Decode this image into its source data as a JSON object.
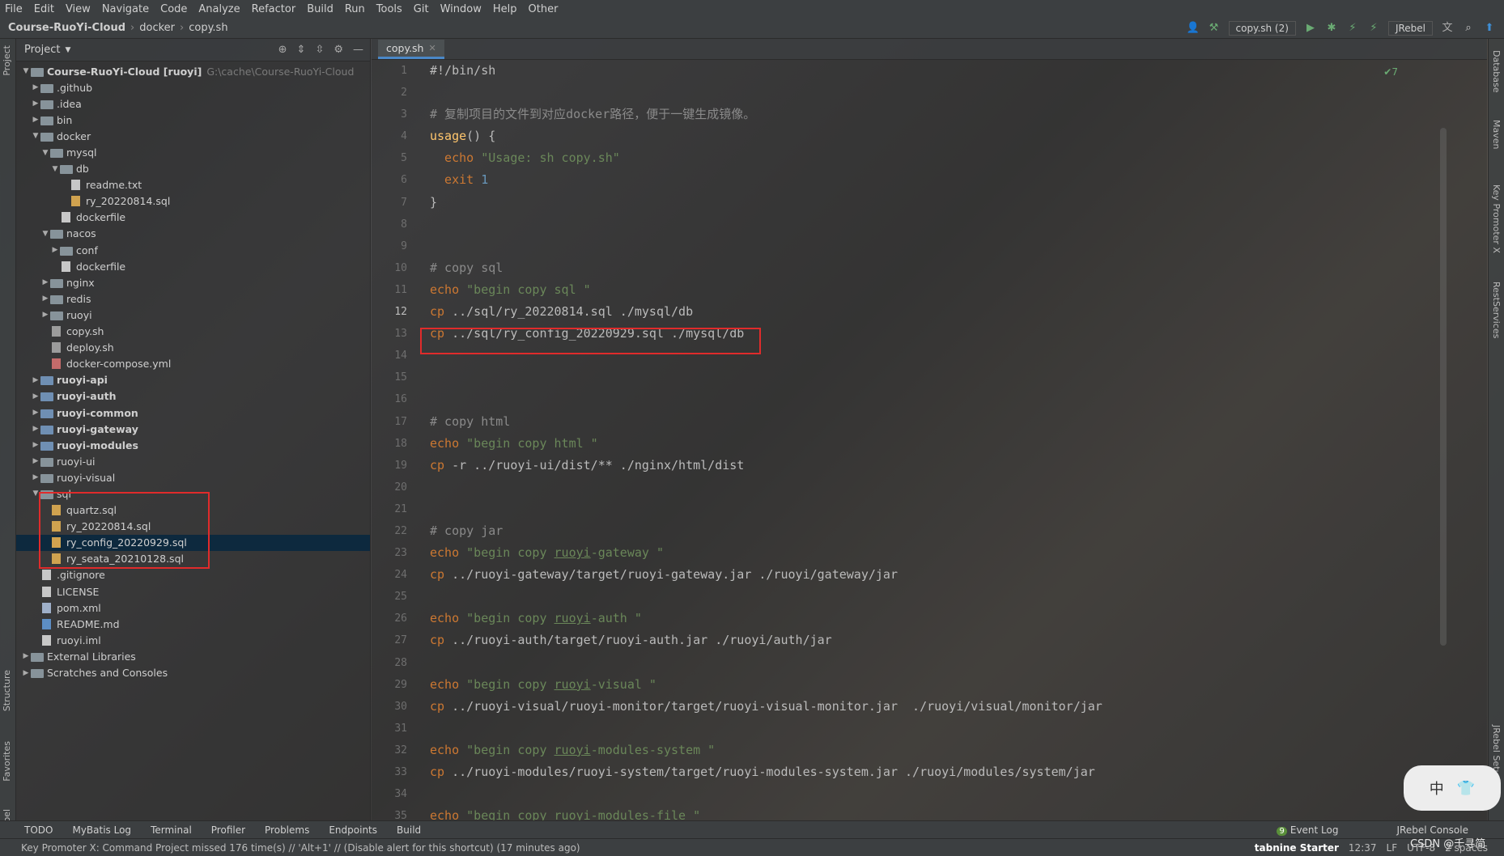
{
  "menu": [
    "File",
    "Edit",
    "View",
    "Navigate",
    "Code",
    "Analyze",
    "Refactor",
    "Build",
    "Run",
    "Tools",
    "Git",
    "Window",
    "Help",
    "Other"
  ],
  "breadcrumb": [
    "Course-RuoYi-Cloud",
    "docker",
    "copy.sh"
  ],
  "toolbar": {
    "run_config": "copy.sh (2)",
    "jrebel": "JRebel"
  },
  "project": {
    "title": "Project",
    "tree": [
      {
        "label": "Course-RuoYi-Cloud [ruoyi]",
        "extra": "G:\\cache\\Course-RuoYi-Cloud",
        "depth": 0,
        "type": "folder",
        "open": true
      },
      {
        "label": ".github",
        "depth": 1,
        "type": "folder"
      },
      {
        "label": ".idea",
        "depth": 1,
        "type": "folder"
      },
      {
        "label": "bin",
        "depth": 1,
        "type": "folder"
      },
      {
        "label": "docker",
        "depth": 1,
        "type": "folder",
        "open": true
      },
      {
        "label": "mysql",
        "depth": 2,
        "type": "folder",
        "open": true
      },
      {
        "label": "db",
        "depth": 3,
        "type": "folder",
        "open": true
      },
      {
        "label": "readme.txt",
        "depth": 4,
        "type": "file"
      },
      {
        "label": "ry_20220814.sql",
        "depth": 4,
        "type": "sql"
      },
      {
        "label": "dockerfile",
        "depth": 3,
        "type": "file"
      },
      {
        "label": "nacos",
        "depth": 2,
        "type": "folder",
        "open": true
      },
      {
        "label": "conf",
        "depth": 3,
        "type": "folder"
      },
      {
        "label": "dockerfile",
        "depth": 3,
        "type": "file"
      },
      {
        "label": "nginx",
        "depth": 2,
        "type": "folder"
      },
      {
        "label": "redis",
        "depth": 2,
        "type": "folder"
      },
      {
        "label": "ruoyi",
        "depth": 2,
        "type": "folder"
      },
      {
        "label": "copy.sh",
        "depth": 2,
        "type": "sh"
      },
      {
        "label": "deploy.sh",
        "depth": 2,
        "type": "sh"
      },
      {
        "label": "docker-compose.yml",
        "depth": 2,
        "type": "yml"
      },
      {
        "label": "ruoyi-api",
        "depth": 1,
        "type": "module",
        "bold": true
      },
      {
        "label": "ruoyi-auth",
        "depth": 1,
        "type": "module",
        "bold": true
      },
      {
        "label": "ruoyi-common",
        "depth": 1,
        "type": "module",
        "bold": true
      },
      {
        "label": "ruoyi-gateway",
        "depth": 1,
        "type": "module",
        "bold": true
      },
      {
        "label": "ruoyi-modules",
        "depth": 1,
        "type": "module",
        "bold": true
      },
      {
        "label": "ruoyi-ui",
        "depth": 1,
        "type": "folder"
      },
      {
        "label": "ruoyi-visual",
        "depth": 1,
        "type": "folder"
      },
      {
        "label": "sql",
        "depth": 1,
        "type": "folder",
        "open": true
      },
      {
        "label": "quartz.sql",
        "depth": 2,
        "type": "sql"
      },
      {
        "label": "ry_20220814.sql",
        "depth": 2,
        "type": "sql"
      },
      {
        "label": "ry_config_20220929.sql",
        "depth": 2,
        "type": "sql",
        "selected": true
      },
      {
        "label": "ry_seata_20210128.sql",
        "depth": 2,
        "type": "sql"
      },
      {
        "label": ".gitignore",
        "depth": 1,
        "type": "file"
      },
      {
        "label": "LICENSE",
        "depth": 1,
        "type": "file"
      },
      {
        "label": "pom.xml",
        "depth": 1,
        "type": "xml"
      },
      {
        "label": "README.md",
        "depth": 1,
        "type": "md"
      },
      {
        "label": "ruoyi.iml",
        "depth": 1,
        "type": "file"
      },
      {
        "label": "External Libraries",
        "depth": 0,
        "type": "lib"
      },
      {
        "label": "Scratches and Consoles",
        "depth": 0,
        "type": "lib"
      }
    ]
  },
  "editor": {
    "tab": "copy.sh",
    "inspections": "✔7",
    "lines": [
      [
        {
          "t": "#!/bin/sh",
          "c": "txt"
        }
      ],
      [],
      [
        {
          "t": "# 复制项目的文件到对应docker路径，便于一键生成镜像。",
          "c": "cm"
        }
      ],
      [
        {
          "t": "usage",
          "c": "fn"
        },
        {
          "t": "() {",
          "c": "txt"
        }
      ],
      [
        {
          "t": "  echo ",
          "c": "kw"
        },
        {
          "t": "\"Usage: sh copy.sh\"",
          "c": "str"
        }
      ],
      [
        {
          "t": "  exit ",
          "c": "kw"
        },
        {
          "t": "1",
          "c": "num"
        }
      ],
      [
        {
          "t": "}",
          "c": "txt"
        }
      ],
      [],
      [],
      [
        {
          "t": "# copy sql",
          "c": "cm"
        }
      ],
      [
        {
          "t": "echo ",
          "c": "kw"
        },
        {
          "t": "\"begin copy sql \"",
          "c": "str"
        }
      ],
      [
        {
          "t": "cp ",
          "c": "kw"
        },
        {
          "t": "../sql/ry_20220814.sql ./mysql/db",
          "c": "txt"
        }
      ],
      [
        {
          "t": "cp ",
          "c": "kw"
        },
        {
          "t": "../sql/ry_config_20220929.sql ./mysql/db",
          "c": "txt"
        }
      ],
      [],
      [],
      [],
      [
        {
          "t": "# copy html",
          "c": "cm"
        }
      ],
      [
        {
          "t": "echo ",
          "c": "kw"
        },
        {
          "t": "\"begin copy html \"",
          "c": "str"
        }
      ],
      [
        {
          "t": "cp ",
          "c": "kw"
        },
        {
          "t": "-r ../ruoyi-ui/dist/** ./nginx/html/dist",
          "c": "txt"
        }
      ],
      [],
      [],
      [
        {
          "t": "# copy jar",
          "c": "cm"
        }
      ],
      [
        {
          "t": "echo ",
          "c": "kw"
        },
        {
          "t": "\"begin copy ",
          "c": "str"
        },
        {
          "t": "ruoyi",
          "c": "str und"
        },
        {
          "t": "-gateway \"",
          "c": "str"
        }
      ],
      [
        {
          "t": "cp ",
          "c": "kw"
        },
        {
          "t": "../ruoyi-gateway/target/ruoyi-gateway.jar ./ruoyi/gateway/jar",
          "c": "txt"
        }
      ],
      [],
      [
        {
          "t": "echo ",
          "c": "kw"
        },
        {
          "t": "\"begin copy ",
          "c": "str"
        },
        {
          "t": "ruoyi",
          "c": "str und"
        },
        {
          "t": "-auth \"",
          "c": "str"
        }
      ],
      [
        {
          "t": "cp ",
          "c": "kw"
        },
        {
          "t": "../ruoyi-auth/target/ruoyi-auth.jar ./ruoyi/auth/jar",
          "c": "txt"
        }
      ],
      [],
      [
        {
          "t": "echo ",
          "c": "kw"
        },
        {
          "t": "\"begin copy ",
          "c": "str"
        },
        {
          "t": "ruoyi",
          "c": "str und"
        },
        {
          "t": "-visual \"",
          "c": "str"
        }
      ],
      [
        {
          "t": "cp ",
          "c": "kw"
        },
        {
          "t": "../ruoyi-visual/ruoyi-monitor/target/ruoyi-visual-monitor.jar  ./ruoyi/visual/monitor/jar",
          "c": "txt"
        }
      ],
      [],
      [
        {
          "t": "echo ",
          "c": "kw"
        },
        {
          "t": "\"begin copy ",
          "c": "str"
        },
        {
          "t": "ruoyi",
          "c": "str und"
        },
        {
          "t": "-modules-system \"",
          "c": "str"
        }
      ],
      [
        {
          "t": "cp ",
          "c": "kw"
        },
        {
          "t": "../ruoyi-modules/ruoyi-system/target/ruoyi-modules-system.jar ./ruoyi/modules/system/jar",
          "c": "txt"
        }
      ],
      [],
      [
        {
          "t": "echo ",
          "c": "kw"
        },
        {
          "t": "\"begin copy ruoyi-modules-file \"",
          "c": "str"
        }
      ]
    ],
    "current_line": 12
  },
  "bottom_tabs": [
    "TODO",
    "MyBatis Log",
    "Terminal",
    "Profiler",
    "Problems",
    "Endpoints",
    "Build"
  ],
  "bottom_right_tabs": [
    "Event Log",
    "JRebel Console"
  ],
  "event_count": "9",
  "status": {
    "message": "Key Promoter X: Command Project missed 176 time(s) // 'Alt+1' // (Disable alert for this shortcut) (17 minutes ago)",
    "plugin": "tabnine Starter",
    "position": "12:37",
    "line_sep": "LF",
    "encoding": "UTF-8",
    "indent": "2 spaces"
  },
  "side_tabs_left": [
    "Project",
    "Structure",
    "Favorites",
    "JRebel"
  ],
  "side_tabs_right": [
    "Database",
    "Maven",
    "Key Promoter X",
    "RestServices",
    "JRebel Setup"
  ],
  "ime": {
    "lang": "中",
    "shirt": "👕"
  },
  "watermark": "CSDN @千寻简"
}
